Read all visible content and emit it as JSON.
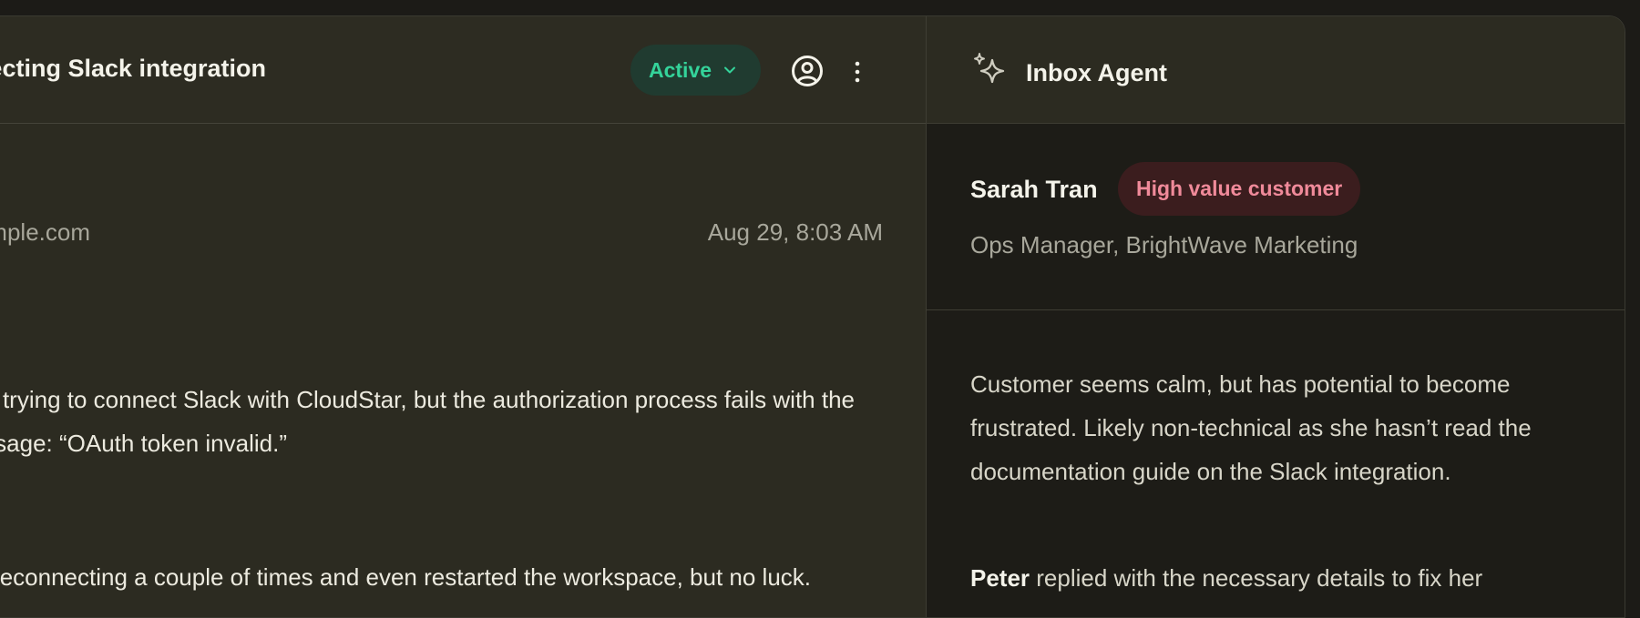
{
  "conversation": {
    "title": "Troubleshooting connecting Slack integration",
    "status": "Active",
    "sender_email": "sarah.tran@example.com",
    "timestamp": "Aug 29, 8:03 AM",
    "message_line1": "I'm trying to connect Slack with CloudStar, but the authorization process fails with the",
    "message_line2": "error message: “OAuth token invalid.”",
    "message_line3": "I've tried reconnecting a couple of times and even restarted the workspace, but no luck."
  },
  "agent": {
    "title": "Inbox Agent",
    "customer_name": "Sarah Tran",
    "customer_tag": "High value customer",
    "customer_role": "Ops Manager, BrightWave Marketing",
    "summary": "Customer seems calm, but has potential to become frustrated. Likely non-technical as she hasn’t read the documentation guide on the Slack integration.",
    "reply_name": "Peter",
    "reply_text": " replied with the necessary details to fix her"
  },
  "colors": {
    "accent_green": "#34d39a",
    "tag_pink": "#f08a9a"
  },
  "icons": [
    "chevron-down-icon",
    "user-circle-icon",
    "more-vertical-icon",
    "sparkles-icon"
  ]
}
